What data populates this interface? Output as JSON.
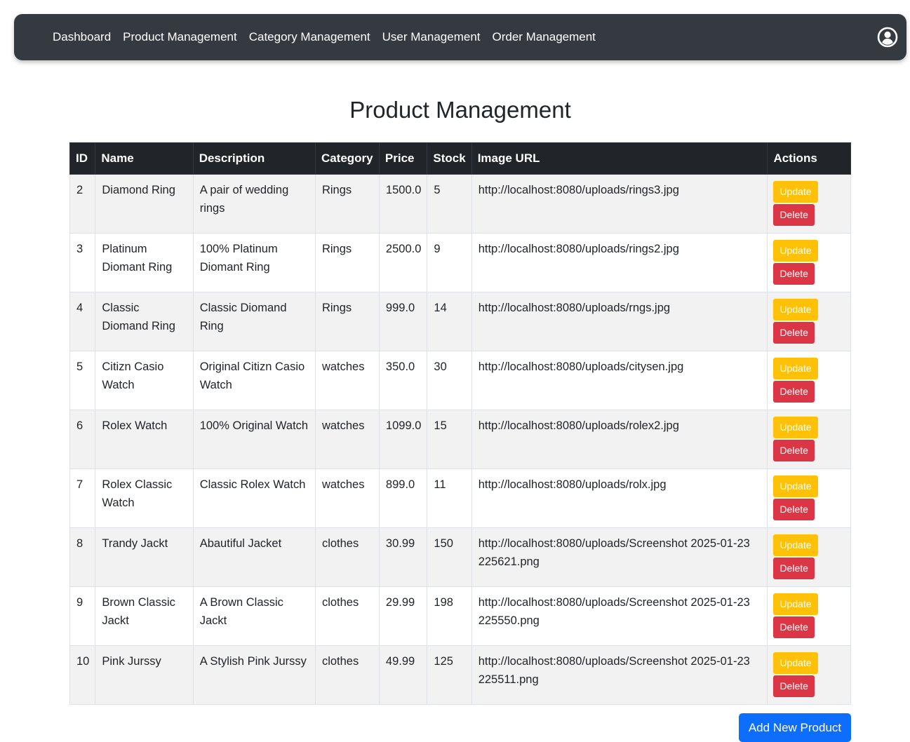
{
  "nav": {
    "links": [
      "Dashboard",
      "Product Management",
      "Category Management",
      "User Management",
      "Order Management"
    ],
    "profile_icon": "user-circle-icon"
  },
  "page": {
    "title": "Product Management",
    "add_button": "Add New Product"
  },
  "table": {
    "headers": [
      "ID",
      "Name",
      "Description",
      "Category",
      "Price",
      "Stock",
      "Image URL",
      "Actions"
    ],
    "update_label": "Update",
    "delete_label": "Delete",
    "rows": [
      {
        "id": "2",
        "name": "Diamond Ring",
        "description": "A pair of wedding rings",
        "category": "Rings",
        "price": "1500.0",
        "stock": "5",
        "image_url": "http://localhost:8080/uploads/rings3.jpg"
      },
      {
        "id": "3",
        "name": "Platinum Diomant Ring",
        "description": "100% Platinum Diomant Ring",
        "category": "Rings",
        "price": "2500.0",
        "stock": "9",
        "image_url": "http://localhost:8080/uploads/rings2.jpg"
      },
      {
        "id": "4",
        "name": "Classic Diomand Ring",
        "description": "Classic Diomand Ring",
        "category": "Rings",
        "price": "999.0",
        "stock": "14",
        "image_url": "http://localhost:8080/uploads/rngs.jpg"
      },
      {
        "id": "5",
        "name": "Citizn Casio Watch",
        "description": "Original Citizn Casio Watch",
        "category": "watches",
        "price": "350.0",
        "stock": "30",
        "image_url": "http://localhost:8080/uploads/citysen.jpg"
      },
      {
        "id": "6",
        "name": "Rolex Watch",
        "description": "100% Original Watch",
        "category": "watches",
        "price": "1099.0",
        "stock": "15",
        "image_url": "http://localhost:8080/uploads/rolex2.jpg"
      },
      {
        "id": "7",
        "name": "Rolex Classic Watch",
        "description": "Classic Rolex Watch",
        "category": "watches",
        "price": "899.0",
        "stock": "11",
        "image_url": "http://localhost:8080/uploads/rolx.jpg"
      },
      {
        "id": "8",
        "name": "Trandy Jackt",
        "description": "Abautiful Jacket",
        "category": "clothes",
        "price": "30.99",
        "stock": "150",
        "image_url": "http://localhost:8080/uploads/Screenshot 2025-01-23 225621.png"
      },
      {
        "id": "9",
        "name": "Brown Classic Jackt",
        "description": "A Brown Classic Jackt",
        "category": "clothes",
        "price": "29.99",
        "stock": "198",
        "image_url": "http://localhost:8080/uploads/Screenshot 2025-01-23 225550.png"
      },
      {
        "id": "10",
        "name": "Pink Jurssy",
        "description": "A Stylish Pink Jurssy",
        "category": "clothes",
        "price": "49.99",
        "stock": "125",
        "image_url": "http://localhost:8080/uploads/Screenshot 2025-01-23 225511.png"
      }
    ]
  },
  "colors": {
    "navbar": "#343a40",
    "table_header": "#212529",
    "update": "#ffc107",
    "delete": "#dc3545",
    "primary": "#0d6efd"
  }
}
